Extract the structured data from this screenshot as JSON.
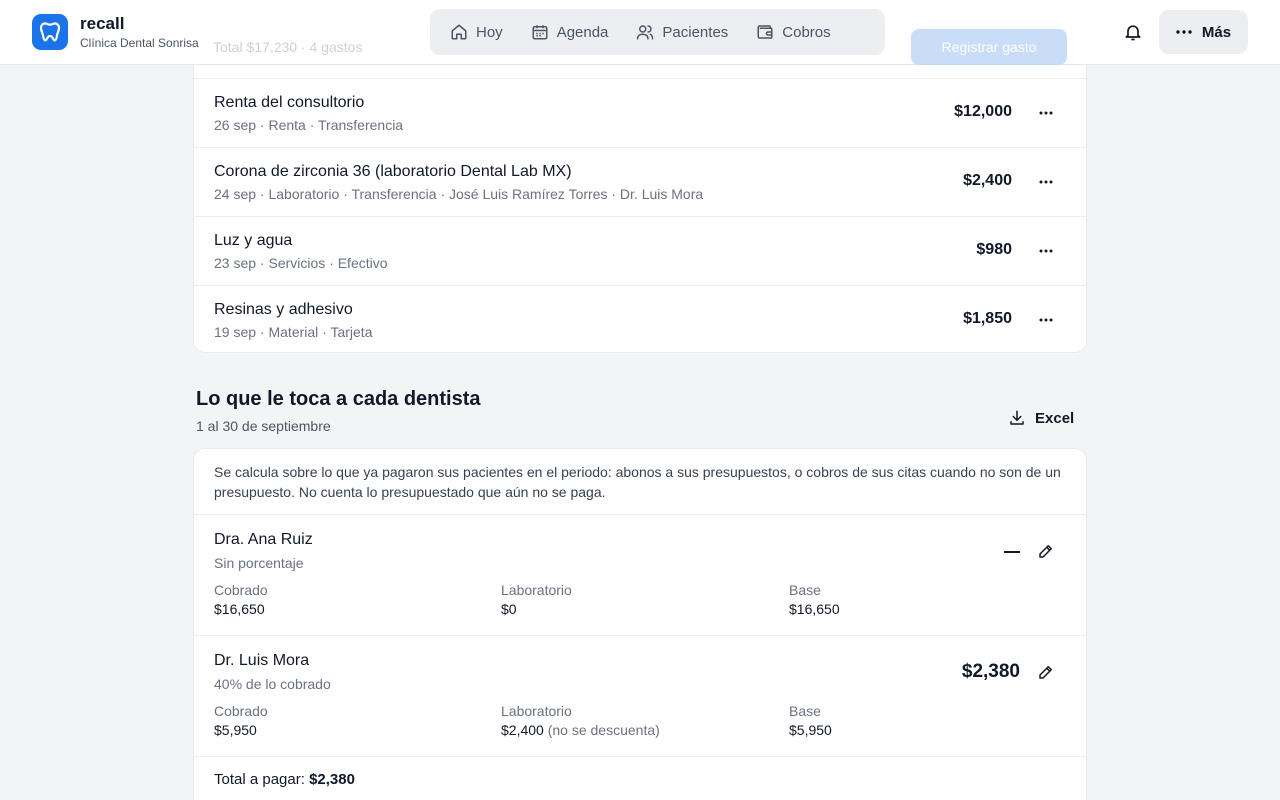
{
  "app": {
    "name": "recall",
    "clinic": "Clínica Dental Sonrisa",
    "accent": "#1a73e8"
  },
  "nav": {
    "items": [
      {
        "label": "Hoy",
        "icon": "home-icon"
      },
      {
        "label": "Agenda",
        "icon": "calendar-icon"
      },
      {
        "label": "Pacientes",
        "icon": "users-icon"
      },
      {
        "label": "Cobros",
        "icon": "wallet-icon"
      }
    ],
    "more_label": "Más"
  },
  "expenses": {
    "header_total": "Total $17,230 · 4 gastos",
    "add_label": "Registrar gasto",
    "rows": [
      {
        "title": "Renta del consultorio",
        "meta": "26 sep · Renta · Transferencia",
        "amount": "$12,000"
      },
      {
        "title": "Corona de zirconia 36 (laboratorio Dental Lab MX)",
        "meta": "24 sep · Laboratorio · Transferencia · José Luis Ramírez Torres · Dr. Luis Mora",
        "amount": "$2,400"
      },
      {
        "title": "Luz y agua",
        "meta": "23 sep · Servicios · Efectivo",
        "amount": "$980"
      },
      {
        "title": "Resinas y adhesivo",
        "meta": "19 sep · Material · Tarjeta",
        "amount": "$1,850"
      }
    ]
  },
  "dentists": {
    "title": "Lo que le toca a cada dentista",
    "period": "1 al 30 de septiembre",
    "excel_label": "Excel",
    "note": "Se calcula sobre lo que ya pagaron sus pacientes en el periodo: abonos a sus presupuestos, o cobros de sus citas cuando no son de un presupuesto. No cuenta lo presupuestado que aún no se paga.",
    "labels": {
      "collected": "Cobrado",
      "lab": "Laboratorio",
      "base": "Base"
    },
    "rows": [
      {
        "name": "Dra. Ana Ruiz",
        "rule": "Sin porcentaje",
        "payout": "",
        "collected": "$16,650",
        "lab": "$0",
        "lab_note": "",
        "base": "$16,650"
      },
      {
        "name": "Dr. Luis Mora",
        "rule": "40% de lo cobrado",
        "payout": "$2,380",
        "collected": "$5,950",
        "lab": "$2,400",
        "lab_note": "(no se descuenta)",
        "base": "$5,950"
      }
    ],
    "total_label": "Total a pagar:",
    "total_value": "$2,380"
  }
}
